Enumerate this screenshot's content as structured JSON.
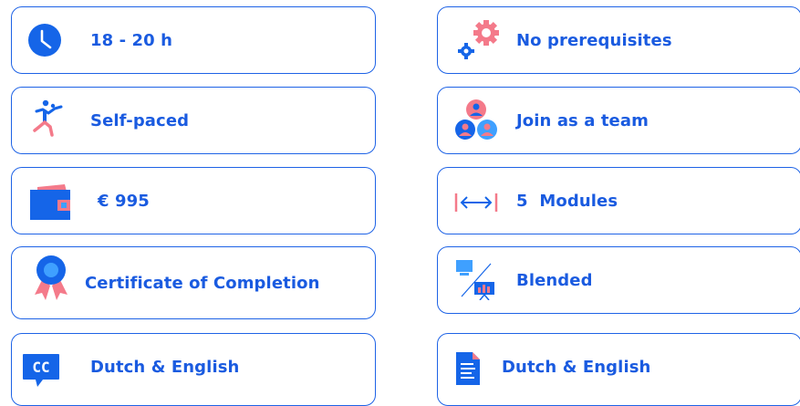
{
  "colors": {
    "accent": "#1a5be0",
    "border": "#1e63e6",
    "pink": "#f47a8a",
    "blue": "#1565e8"
  },
  "cards": [
    {
      "label": "18 - 20 h",
      "icon": "clock-icon"
    },
    {
      "label": "No prerequisites",
      "icon": "gears-icon"
    },
    {
      "label": "Self-paced",
      "icon": "running-person-icon"
    },
    {
      "label": "Join as a team",
      "icon": "team-icon"
    },
    {
      "label": "€ 995",
      "icon": "wallet-icon"
    },
    {
      "label": "5  Modules",
      "icon": "arrow-range-icon"
    },
    {
      "label": "Certificate of Completion",
      "icon": "award-ribbon-icon"
    },
    {
      "label": "Blended",
      "icon": "presentation-icon"
    },
    {
      "label": "Dutch & English",
      "icon": "closed-captions-icon"
    },
    {
      "label": "Dutch & English",
      "icon": "document-icon"
    }
  ],
  "icon_text": {
    "cc": "CC"
  }
}
